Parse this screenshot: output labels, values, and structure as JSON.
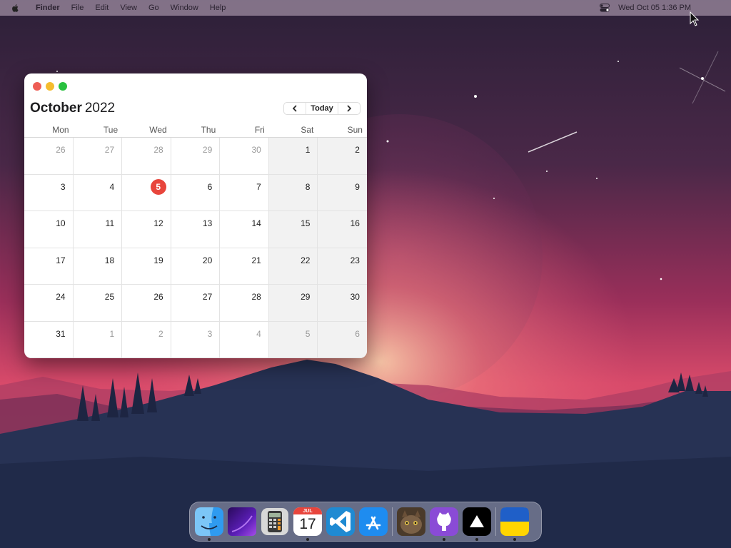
{
  "menubar": {
    "app_name": "Finder",
    "items": [
      "File",
      "Edit",
      "View",
      "Go",
      "Window",
      "Help"
    ],
    "clock": "Wed Oct 05  1:36 PM"
  },
  "calendar": {
    "month": "October",
    "year": "2022",
    "today_label": "Today",
    "prev_icon": "chevron-left-icon",
    "next_icon": "chevron-right-icon",
    "weekdays": [
      "Mon",
      "Tue",
      "Wed",
      "Thu",
      "Fri",
      "Sat",
      "Sun"
    ],
    "weeks": [
      [
        "26",
        "27",
        "28",
        "29",
        "30",
        "1",
        "2"
      ],
      [
        "3",
        "4",
        "5",
        "6",
        "7",
        "8",
        "9"
      ],
      [
        "10",
        "11",
        "12",
        "13",
        "14",
        "15",
        "16"
      ],
      [
        "17",
        "18",
        "19",
        "20",
        "21",
        "22",
        "23"
      ],
      [
        "24",
        "25",
        "26",
        "27",
        "28",
        "29",
        "30"
      ],
      [
        "31",
        "1",
        "2",
        "3",
        "4",
        "5",
        "6"
      ]
    ],
    "today_date": "5",
    "accent_color": "#e8453c"
  },
  "dock": {
    "calendar_icon_month": "JUL",
    "calendar_icon_day": "17",
    "apps": [
      "finder-icon",
      "launchpad-icon",
      "calculator-icon",
      "calendar-icon",
      "vscode-icon",
      "app-store-icon",
      "cat-photo-icon",
      "github-desktop-icon",
      "vercel-icon",
      "ukraine-flag-icon"
    ]
  }
}
